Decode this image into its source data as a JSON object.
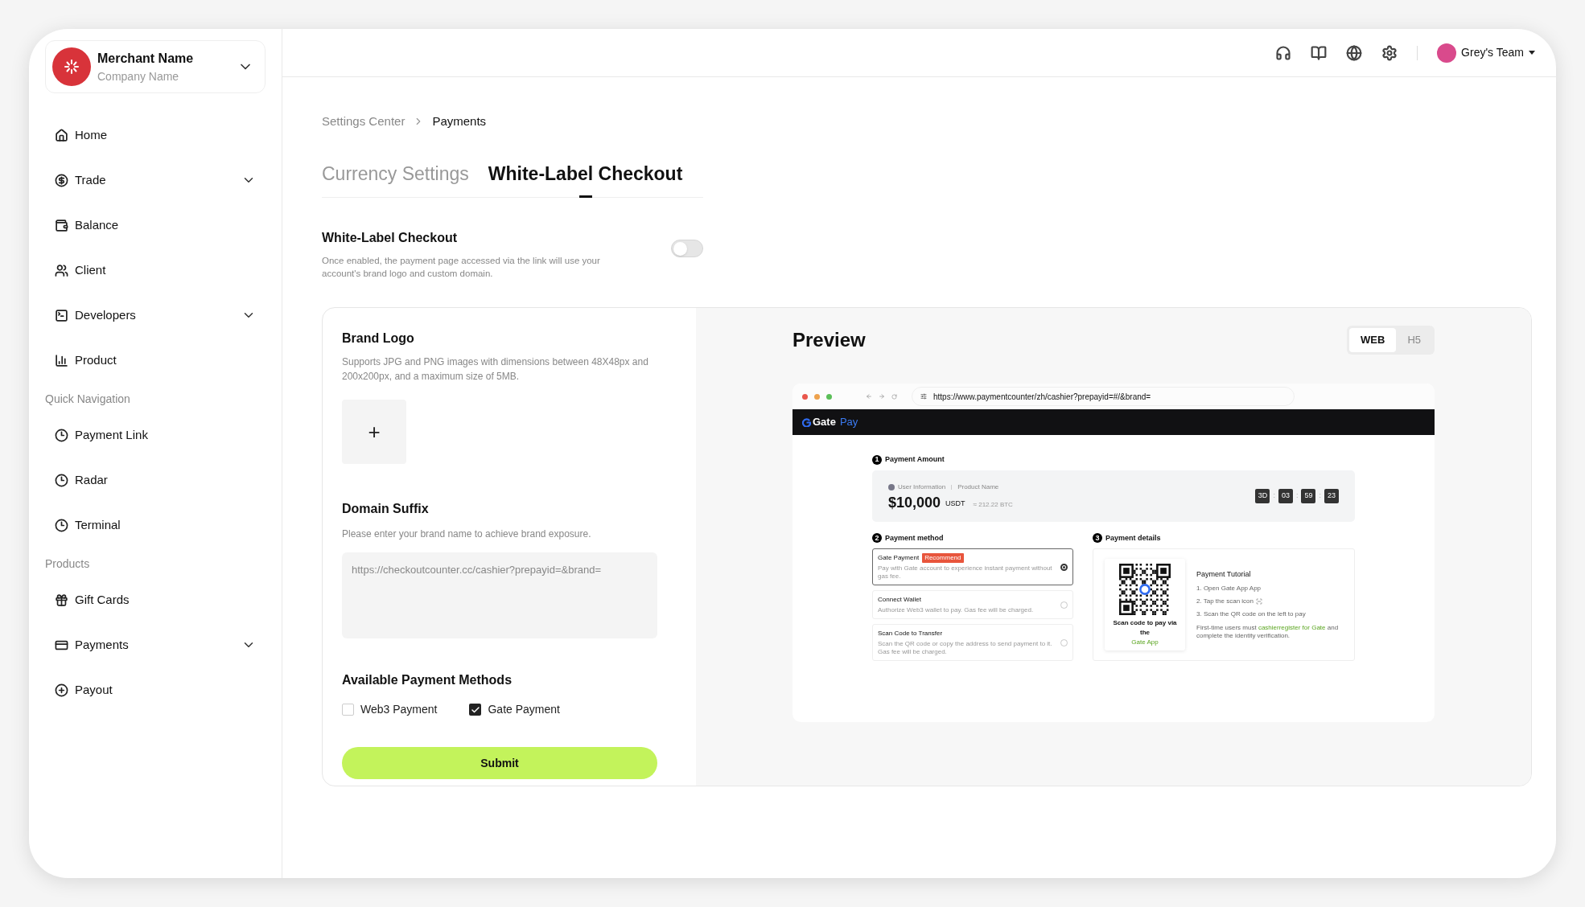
{
  "merchant": {
    "name": "Merchant Name",
    "company": "Company Name"
  },
  "sidebar": {
    "groups": [
      {
        "items": [
          {
            "label": "Home",
            "expandable": false
          },
          {
            "label": "Trade",
            "expandable": true
          },
          {
            "label": "Balance",
            "expandable": false
          },
          {
            "label": "Client",
            "expandable": false
          },
          {
            "label": "Developers",
            "expandable": true
          },
          {
            "label": "Product",
            "expandable": false
          }
        ]
      },
      {
        "heading": "Quick Navigation",
        "items": [
          {
            "label": "Payment Link",
            "expandable": false
          },
          {
            "label": "Radar",
            "expandable": false
          },
          {
            "label": "Terminal",
            "expandable": false
          }
        ]
      },
      {
        "heading": "Products",
        "items": [
          {
            "label": "Gift Cards",
            "expandable": false
          },
          {
            "label": "Payments",
            "expandable": true
          },
          {
            "label": "Payout",
            "expandable": false
          }
        ]
      }
    ]
  },
  "header": {
    "team": "Grey's Team"
  },
  "breadcrumb": [
    "Settings Center",
    "Payments"
  ],
  "tabs": [
    {
      "label": "Currency Settings",
      "selected": false
    },
    {
      "label": "White-Label Checkout",
      "selected": true
    }
  ],
  "white_label": {
    "title": "White-Label Checkout",
    "description": "Once enabled, the payment page accessed via the link will use your account's brand logo and custom domain.",
    "on": false
  },
  "brand_logo": {
    "title": "Brand Logo",
    "description": "Supports JPG and PNG images with dimensions between 48X48px and 200x200px, and a maximum size of 5MB.",
    "upload": "+"
  },
  "domain_suffix": {
    "title": "Domain Suffix",
    "description": "Please enter your brand name to achieve brand exposure.",
    "placeholder": "https://checkoutcounter.cc/cashier?prepayid=&brand="
  },
  "payment_methods": {
    "title": "Available Payment Methods",
    "options": [
      {
        "label": "Web3 Payment",
        "checked": false
      },
      {
        "label": "Gate Payment",
        "checked": true
      }
    ]
  },
  "submit": "Submit",
  "preview": {
    "title": "Preview",
    "modes": [
      {
        "label": "WEB",
        "selected": true
      },
      {
        "label": "H5",
        "selected": false
      }
    ],
    "url": "https://www.paymentcounter/zh/cashier?prepayid=#/&brand=",
    "brand": [
      "Gate",
      "Pay"
    ],
    "amount": {
      "step": "1",
      "title": "Payment Amount",
      "user": "User Information",
      "product": "Product Name",
      "value": "$10,000",
      "currency": "USDT",
      "approx": "≈ 212.22 BTC",
      "countdown": [
        "3D",
        "03",
        "59",
        "23"
      ],
      "separator": ":"
    },
    "method": {
      "step": "2",
      "title": "Payment method",
      "options": [
        {
          "name": "Gate Payment",
          "badge": "Recommend",
          "description": "Pay with Gate account to experience instant payment without gas fee.",
          "selected": true
        },
        {
          "name": "Connect Wallet",
          "description": "Authorize Web3 wallet to pay. Gas fee will be charged.",
          "selected": false
        },
        {
          "name": "Scan Code to Transfer",
          "description": "Scan the QR code or copy the address to send payment to it. Gas fee will be charged.",
          "selected": false
        }
      ]
    },
    "details": {
      "step": "3",
      "title": "Payment details",
      "qr_caption": "Scan code to pay via the",
      "qr_link": "Gate App",
      "tutorial_title": "Payment Tutorial",
      "steps": [
        "1. Open Gate App App",
        "2. Tap the scan icon",
        "3. Scan the QR code on the left to pay"
      ],
      "note_before": "First-time users must",
      "note_link": "cashierregister for Gate",
      "note_after": "and complete the identity verification."
    }
  }
}
